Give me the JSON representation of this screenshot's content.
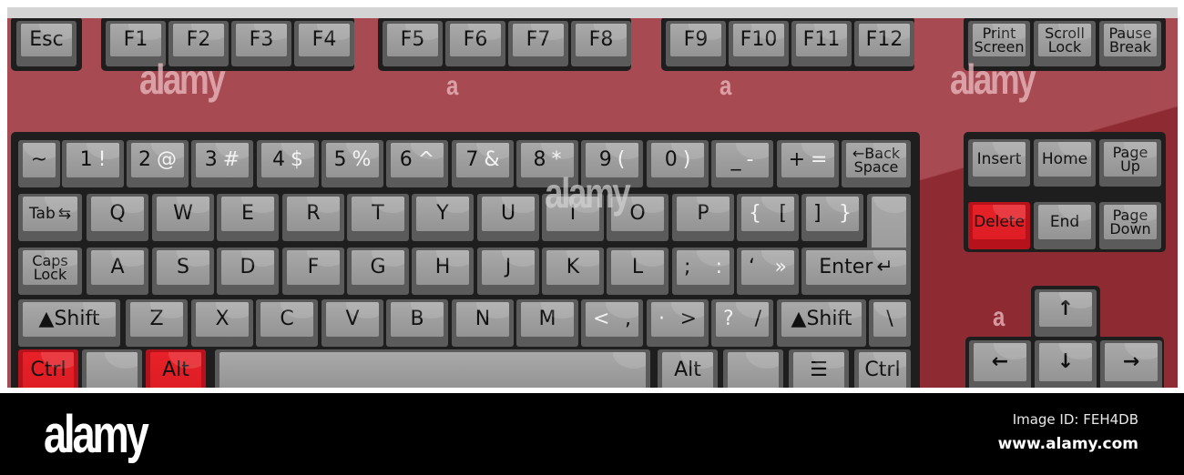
{
  "colors": {
    "case_red": "#a84a52",
    "case_dark_red": "#8e2a32",
    "key_grey": "#a9a9a9",
    "highlight_red": "#e82128",
    "panel_dark": "#1e1e1e"
  },
  "function_row": {
    "esc": "Esc",
    "group1": [
      "F1",
      "F2",
      "F3",
      "F4"
    ],
    "group2": [
      "F5",
      "F6",
      "F7",
      "F8"
    ],
    "group3": [
      "F9",
      "F10",
      "F11",
      "F12"
    ],
    "system": [
      {
        "line1": "Print",
        "line2": "Screen"
      },
      {
        "line1": "Scroll",
        "line2": "Lock"
      },
      {
        "line1": "Pause",
        "line2": "Break"
      }
    ]
  },
  "number_row": {
    "tilde": "~",
    "keys": [
      {
        "main": "1",
        "sym": "!"
      },
      {
        "main": "2",
        "sym": "@"
      },
      {
        "main": "3",
        "sym": "#"
      },
      {
        "main": "4",
        "sym": "$"
      },
      {
        "main": "5",
        "sym": "%"
      },
      {
        "main": "6",
        "sym": "^"
      },
      {
        "main": "7",
        "sym": "&"
      },
      {
        "main": "8",
        "sym": "*"
      },
      {
        "main": "9",
        "sym": "("
      },
      {
        "main": "0",
        "sym": ")"
      },
      {
        "main": "_",
        "sym": "-"
      },
      {
        "main": "+",
        "sym": "="
      }
    ],
    "backspace": {
      "arrow": "←",
      "line1": "Back",
      "line2": "Space"
    }
  },
  "qwerty_row": {
    "tab": "Tab",
    "tab_arrows": "⇆",
    "letters": [
      "Q",
      "W",
      "E",
      "R",
      "T",
      "Y",
      "U",
      "I",
      "O",
      "P"
    ],
    "brackets": [
      {
        "a": "{",
        "b": "["
      },
      {
        "a": "]",
        "b": "}"
      }
    ]
  },
  "home_row": {
    "caps": {
      "line1": "Caps",
      "line2": "Lock"
    },
    "letters": [
      "A",
      "S",
      "D",
      "F",
      "G",
      "H",
      "J",
      "K",
      "L"
    ],
    "punct": [
      {
        "a": ";",
        "b": ":"
      },
      {
        "a": "‘",
        "b": "»"
      }
    ],
    "enter": "Enter",
    "enter_arrow": "↵"
  },
  "shift_row": {
    "left_shift": "▲Shift",
    "letters": [
      "Z",
      "X",
      "C",
      "V",
      "B",
      "N",
      "M"
    ],
    "punct": [
      {
        "a": "<",
        "b": ","
      },
      {
        "a": "·",
        "b": ">"
      },
      {
        "a": "?",
        "b": "/"
      }
    ],
    "right_shift": "▲Shift",
    "backslash": "\\"
  },
  "bottom_row": {
    "left_ctrl": "Ctrl",
    "left_alt": "Alt",
    "right_alt": "Alt",
    "menu_icon": "☰",
    "right_ctrl": "Ctrl"
  },
  "nav_cluster": {
    "insert": "Insert",
    "home": "Home",
    "page_up": {
      "line1": "Page",
      "line2": "Up"
    },
    "delete": "Delete",
    "end": "End",
    "page_down": {
      "line1": "Page",
      "line2": "Down"
    }
  },
  "arrows": {
    "up": "↑",
    "left": "←",
    "down": "↓",
    "right": "→"
  },
  "watermark": {
    "text": "alamy",
    "letter": "a"
  },
  "footer": {
    "logo": "alamy",
    "image_id": "Image ID: FEH4DB",
    "url": "www.alamy.com"
  }
}
